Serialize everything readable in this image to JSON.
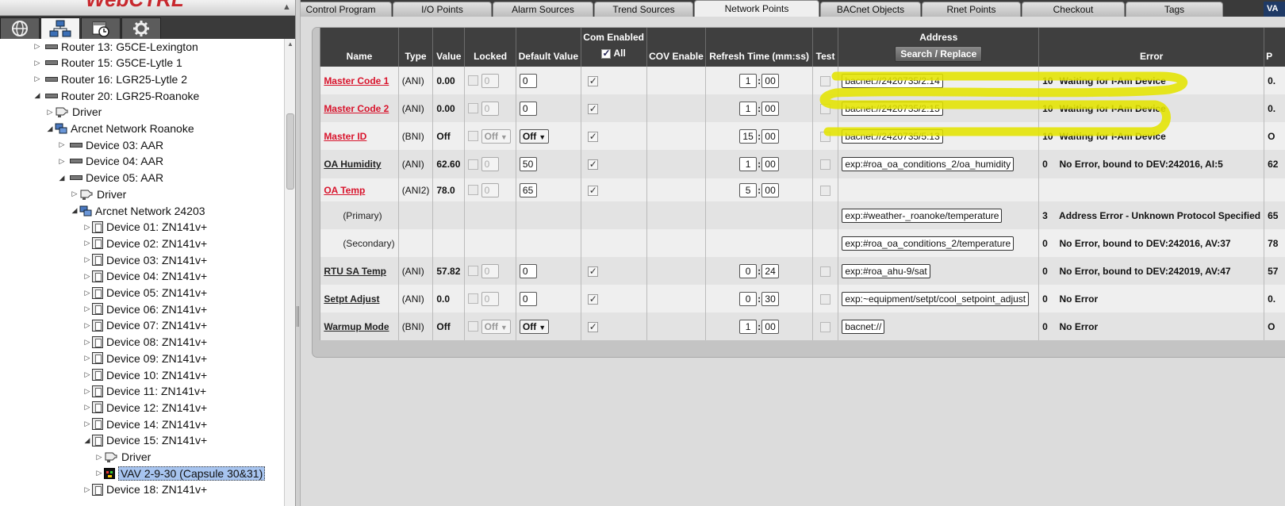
{
  "app": {
    "logo_text": "WebCTRL"
  },
  "left_nav": {
    "tabs": [
      {
        "name": "geographic",
        "icon": "globe-icon"
      },
      {
        "name": "network",
        "icon": "network-icon"
      },
      {
        "name": "schedules",
        "icon": "calendar-clock-icon"
      },
      {
        "name": "equipment",
        "icon": "gear-icon"
      }
    ],
    "active_tab": "network"
  },
  "tree": {
    "items": [
      {
        "label": "Router 13: G5CE-Lexington",
        "icon": "router-icon",
        "expanded": false
      },
      {
        "label": "Router 15: G5CE-Lytle 1",
        "icon": "router-icon",
        "expanded": false
      },
      {
        "label": "Router 16: LGR25-Lytle 2",
        "icon": "router-icon",
        "expanded": false
      },
      {
        "label": "Router 20: LGR25-Roanoke",
        "icon": "router-icon",
        "expanded": true
      },
      {
        "label": "Driver",
        "icon": "driver-icon",
        "expanded": false
      },
      {
        "label": "Arcnet Network Roanoke",
        "icon": "network-icon",
        "expanded": true
      },
      {
        "label": "Device 03: AAR",
        "icon": "router-icon",
        "expanded": false
      },
      {
        "label": "Device 04: AAR",
        "icon": "router-icon",
        "expanded": false
      },
      {
        "label": "Device 05: AAR",
        "icon": "router-icon",
        "expanded": true
      },
      {
        "label": "Driver",
        "icon": "driver-icon",
        "expanded": false
      },
      {
        "label": "Arcnet Network 24203",
        "icon": "network-icon",
        "expanded": true
      },
      {
        "label": "Device 01: ZN141v+",
        "icon": "device-icon",
        "expanded": false
      },
      {
        "label": "Device 02: ZN141v+",
        "icon": "device-icon",
        "expanded": false
      },
      {
        "label": "Device 03: ZN141v+",
        "icon": "device-icon",
        "expanded": false
      },
      {
        "label": "Device 04: ZN141v+",
        "icon": "device-icon",
        "expanded": false
      },
      {
        "label": "Device 05: ZN141v+",
        "icon": "device-icon",
        "expanded": false
      },
      {
        "label": "Device 06: ZN141v+",
        "icon": "device-icon",
        "expanded": false
      },
      {
        "label": "Device 07: ZN141v+",
        "icon": "device-icon",
        "expanded": false
      },
      {
        "label": "Device 08: ZN141v+",
        "icon": "device-icon",
        "expanded": false
      },
      {
        "label": "Device 09: ZN141v+",
        "icon": "device-icon",
        "expanded": false
      },
      {
        "label": "Device 10: ZN141v+",
        "icon": "device-icon",
        "expanded": false
      },
      {
        "label": "Device 11: ZN141v+",
        "icon": "device-icon",
        "expanded": false
      },
      {
        "label": "Device 12: ZN141v+",
        "icon": "device-icon",
        "expanded": false
      },
      {
        "label": "Device 14: ZN141v+",
        "icon": "device-icon",
        "expanded": false
      },
      {
        "label": "Device 15: ZN141v+",
        "icon": "device-icon",
        "expanded": true
      },
      {
        "label": "Driver",
        "icon": "driver-icon",
        "expanded": false
      },
      {
        "label": "VAV 2-9-30 (Capsule 30&31)",
        "icon": "vav-icon",
        "expanded": false,
        "selected": true
      },
      {
        "label": "Device 18: ZN141v+",
        "icon": "device-icon",
        "expanded": false
      }
    ]
  },
  "tabs": [
    {
      "label": "Control Program"
    },
    {
      "label": "I/O Points"
    },
    {
      "label": "Alarm Sources"
    },
    {
      "label": "Trend Sources"
    },
    {
      "label": "Network Points",
      "active": true
    },
    {
      "label": "BACnet Objects"
    },
    {
      "label": "Rnet Points"
    },
    {
      "label": "Checkout"
    },
    {
      "label": "Tags"
    }
  ],
  "tab_overflow_label": "VA",
  "table": {
    "headers": {
      "name": "Name",
      "type": "Type",
      "value": "Value",
      "locked": "Locked",
      "default_value": "Default Value",
      "com_enabled": "Com Enabled",
      "com_enabled_all": "All",
      "cov_enable": "COV Enable",
      "refresh_time": "Refresh Time (mm:ss)",
      "test": "Test",
      "address": "Address",
      "search_replace": "Search / Replace",
      "error": "Error",
      "extra": "P"
    },
    "rows": [
      {
        "name": "Master Code 1",
        "name_red": true,
        "type": "(ANI)",
        "value": "0.00",
        "locked_value": "0",
        "default": "0",
        "com_enabled": true,
        "min": "1",
        "sec": "00",
        "address": "bacnet://2420735/2:14",
        "error_code": "10",
        "error_text": "Waiting for I-Am Device",
        "extra": "0."
      },
      {
        "name": "Master Code 2",
        "name_red": true,
        "type": "(ANI)",
        "value": "0.00",
        "locked_value": "0",
        "default": "0",
        "com_enabled": true,
        "min": "1",
        "sec": "00",
        "address": "bacnet://2420735/2:15",
        "error_code": "10",
        "error_text": "Waiting for I-Am Device",
        "extra": "0."
      },
      {
        "name": "Master ID",
        "name_red": true,
        "type": "(BNI)",
        "value": "Off",
        "locked_select": "Off",
        "default_select": "Off",
        "com_enabled": true,
        "min": "15",
        "sec": "00",
        "address": "bacnet://2420735/5:13",
        "error_code": "10",
        "error_text": "Waiting for I-Am Device",
        "extra": "O"
      },
      {
        "name": "OA Humidity",
        "name_red": false,
        "type": "(ANI)",
        "value": "62.60",
        "locked_value": "0",
        "default": "50",
        "com_enabled": true,
        "min": "1",
        "sec": "00",
        "address": "exp:#roa_oa_conditions_2/oa_humidity",
        "error_code": "0",
        "error_text": "No Error, bound to DEV:242016, AI:5",
        "extra": "62"
      },
      {
        "name": "OA Temp",
        "name_red": true,
        "type": "(ANI2)",
        "value": "78.0",
        "locked_value": "0",
        "default": "65",
        "com_enabled": true,
        "min": "5",
        "sec": "00",
        "address": "",
        "error_code": "",
        "error_text": "",
        "extra": ""
      },
      {
        "sub": "(Primary)",
        "address": "exp:#weather-_roanoke/temperature",
        "error_code": "3",
        "error_text": "Address Error - Unknown Protocol Specified",
        "extra": "65"
      },
      {
        "sub": "(Secondary)",
        "address": "exp:#roa_oa_conditions_2/temperature",
        "error_code": "0",
        "error_text": "No Error, bound to DEV:242016, AV:37",
        "extra": "78"
      },
      {
        "name": "RTU SA Temp",
        "name_red": false,
        "type": "(ANI)",
        "value": "57.82",
        "locked_value": "0",
        "default": "0",
        "com_enabled": true,
        "min": "0",
        "sec": "24",
        "address": "exp:#roa_ahu-9/sat",
        "error_code": "0",
        "error_text": "No Error, bound to DEV:242019, AV:47",
        "extra": "57"
      },
      {
        "name": "Setpt Adjust",
        "name_red": false,
        "type": "(ANI)",
        "value": "0.0",
        "locked_value": "0",
        "default": "0",
        "com_enabled": true,
        "min": "0",
        "sec": "30",
        "address": "exp:~equipment/setpt/cool_setpoint_adjust",
        "error_code": "0",
        "error_text": "No Error",
        "extra": "0."
      },
      {
        "name": "Warmup Mode",
        "name_red": false,
        "type": "(BNI)",
        "value": "Off",
        "locked_select": "Off",
        "default_select": "Off",
        "com_enabled": true,
        "min": "1",
        "sec": "00",
        "address": "bacnet://",
        "error_code": "0",
        "error_text": "No Error",
        "extra": "O"
      }
    ]
  },
  "colors": {
    "highlight": "#e4e400",
    "link_red": "#d8142c",
    "header_bg": "#3f3f3f",
    "selection": "#a7c4ef"
  }
}
